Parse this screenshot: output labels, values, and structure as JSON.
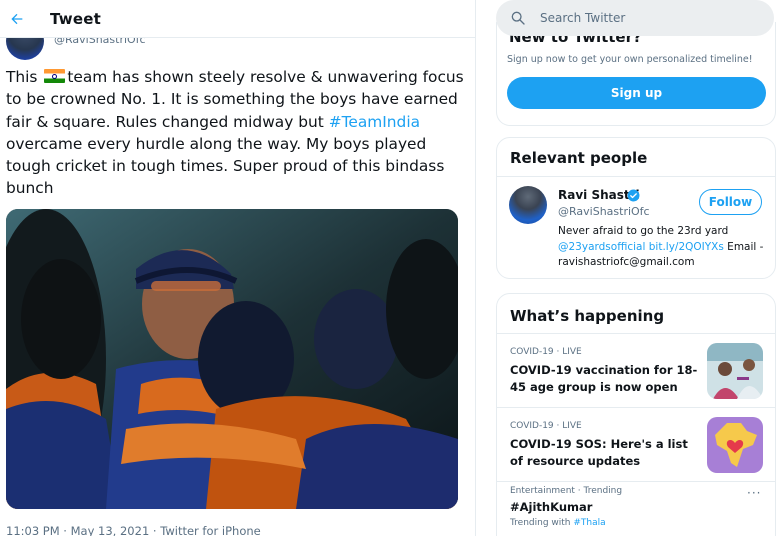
{
  "header": {
    "title": "Tweet",
    "back_icon": "arrow-left-icon"
  },
  "tweet": {
    "author_handle": "@RaviShastriOfc",
    "text_parts": {
      "p1": "This ",
      "flag": "india-flag-emoji",
      "p2": "team has shown steely resolve & unwavering focus to be crowned No. 1. It is something the boys have earned fair & square. Rules changed midway but ",
      "hashtag": "#TeamIndia",
      "p3": " overcame every hurdle along the way. My boys played tough cricket in tough times. Super proud of this bindass bunch"
    },
    "meta": "11:03 PM · May 13, 2021 · Twitter for iPhone"
  },
  "search": {
    "placeholder": "Search Twitter"
  },
  "new_to_twitter": {
    "title": "New to Twitter?",
    "subtitle": "Sign up now to get your own personalized timeline!",
    "signup_label": "Sign up"
  },
  "relevant_people": {
    "title": "Relevant people",
    "person": {
      "name": "Ravi Shastri",
      "handle": "@RaviShastriOfc",
      "follow_label": "Follow",
      "bio_text": "Never afraid to go the 23rd yard ",
      "bio_link1": "@23yardsofficial",
      "bio_link2": "bit.ly/2QOIYXs",
      "bio_end": " Email - ravishastriofc@gmail.com"
    }
  },
  "whats_happening": {
    "title": "What’s happening",
    "trends": [
      {
        "meta": "COVID-19 · LIVE",
        "title": "COVID-19 vaccination for 18-45 age group is now open"
      },
      {
        "meta": "COVID-19 · LIVE",
        "title": "COVID-19 SOS: Here's a list of resource updates"
      },
      {
        "meta": "Entertainment · Trending",
        "title": "#AjithKumar",
        "trending_with_label": "Trending with ",
        "trending_with_tag": "#Thala",
        "more": "···"
      }
    ]
  },
  "colors": {
    "accent": "#1da1f2",
    "secondary_text": "#5b7083",
    "border": "#e6ecf0"
  }
}
